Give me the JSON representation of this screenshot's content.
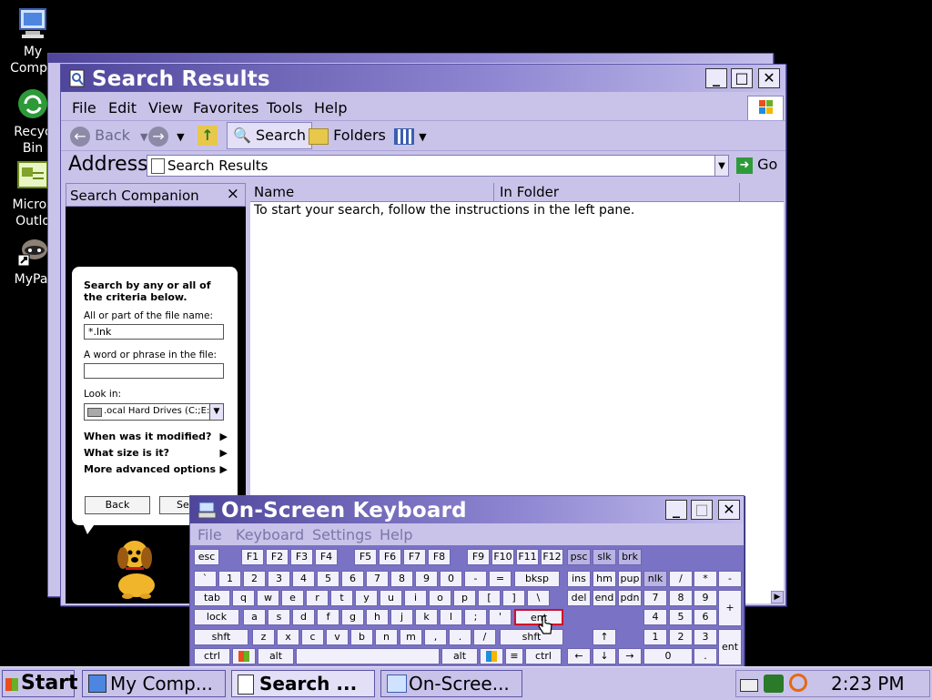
{
  "desktop": {
    "icons": [
      {
        "label": "My Compu"
      },
      {
        "label": "Recyc Bin"
      },
      {
        "label": "Micros Outlo"
      },
      {
        "label": "MyPal"
      }
    ]
  },
  "explorer": {
    "title": "Search Results",
    "menu": [
      "File",
      "Edit",
      "View",
      "Favorites",
      "Tools",
      "Help"
    ],
    "toolbar": {
      "back": "Back",
      "search": "Search",
      "folders": "Folders"
    },
    "address": {
      "label": "Address",
      "value": "Search Results",
      "go": "Go"
    },
    "companion": {
      "title": "Search Companion",
      "close": "×",
      "intro": "Search by any or all of the criteria below.",
      "filename_label": "All or part of the file name:",
      "filename_value": "*.lnk",
      "phrase_label": "A word or phrase in the file:",
      "phrase_value": "",
      "lookin_label": "Look in:",
      "lookin_value": ".ocal Hard Drives (C:;E:)",
      "options": [
        "When was it modified?",
        "What size is it?",
        "More advanced options"
      ],
      "back_button": "Back",
      "search_button": "Se"
    },
    "columns": [
      "Name",
      "In Folder"
    ],
    "empty_message": "To start your search, follow the instructions in the left pane."
  },
  "osk": {
    "title": "On-Screen Keyboard",
    "menu": [
      "File",
      "Keyboard",
      "Settings",
      "Help"
    ],
    "rows": {
      "r1": [
        "esc",
        "F1",
        "F2",
        "F3",
        "F4",
        "F5",
        "F6",
        "F7",
        "F8",
        "F9",
        "F10",
        "F11",
        "F12",
        "psc",
        "slk",
        "brk"
      ],
      "r2": [
        "`",
        "1",
        "2",
        "3",
        "4",
        "5",
        "6",
        "7",
        "8",
        "9",
        "0",
        "-",
        "=",
        "bksp",
        "ins",
        "hm",
        "pup",
        "nlk",
        "/",
        "*",
        "-"
      ],
      "r3": [
        "tab",
        "q",
        "w",
        "e",
        "r",
        "t",
        "y",
        "u",
        "i",
        "o",
        "p",
        "[",
        "]",
        "\\",
        "del",
        "end",
        "pdn",
        "7",
        "8",
        "9",
        "+"
      ],
      "r4": [
        "lock",
        "a",
        "s",
        "d",
        "f",
        "g",
        "h",
        "j",
        "k",
        "l",
        ";",
        "'",
        "ent",
        "4",
        "5",
        "6"
      ],
      "r5": [
        "shft",
        "z",
        "x",
        "c",
        "v",
        "b",
        "n",
        "m",
        ",",
        ".",
        "/",
        "shft",
        "↑",
        "1",
        "2",
        "3",
        "ent"
      ],
      "r6": [
        "ctrl",
        "alt",
        "alt",
        "ctrl",
        "←",
        "↓",
        "→",
        "0",
        "."
      ]
    }
  },
  "taskbar": {
    "start": "Start",
    "buttons": [
      "My Comp...",
      "Search ...",
      "On-Scree..."
    ],
    "clock": "2:23 PM"
  }
}
